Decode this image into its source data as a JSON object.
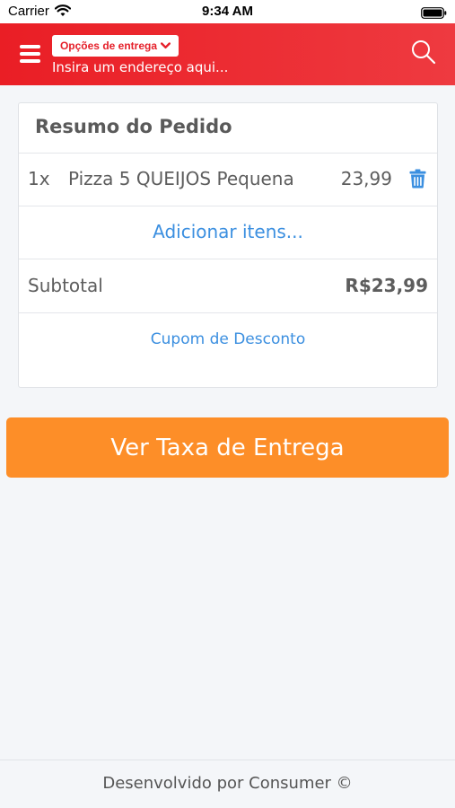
{
  "status_bar": {
    "carrier": "Carrier",
    "time": "9:34 AM",
    "wifi_icon": "wifi-icon",
    "battery_icon": "battery-icon"
  },
  "header": {
    "menu_icon": "hamburger-menu-icon",
    "delivery_options_label": "Opções de entrega",
    "delivery_chevron_icon": "chevron-down-icon",
    "address_placeholder": "Insira um endereço aqui...",
    "search_icon": "search-icon",
    "background_color": "#ea1e25"
  },
  "order_summary": {
    "title": "Resumo do Pedido",
    "items": [
      {
        "quantity": "1x",
        "name": "Pizza 5 QUEIJOS Pequena",
        "price": "23,99",
        "delete_icon": "trash-icon"
      }
    ],
    "add_items_label": "Adicionar itens...",
    "subtotal_label": "Subtotal",
    "subtotal_value": "R$23,99",
    "coupon_label": "Cupom de Desconto"
  },
  "actions": {
    "delivery_fee_button": "Ver Taxa de Entrega",
    "button_color": "#fd8e28"
  },
  "footer": {
    "text": "Desenvolvido por Consumer ©"
  },
  "colors": {
    "link": "#3b8fe0",
    "background": "#f4f6f9"
  }
}
